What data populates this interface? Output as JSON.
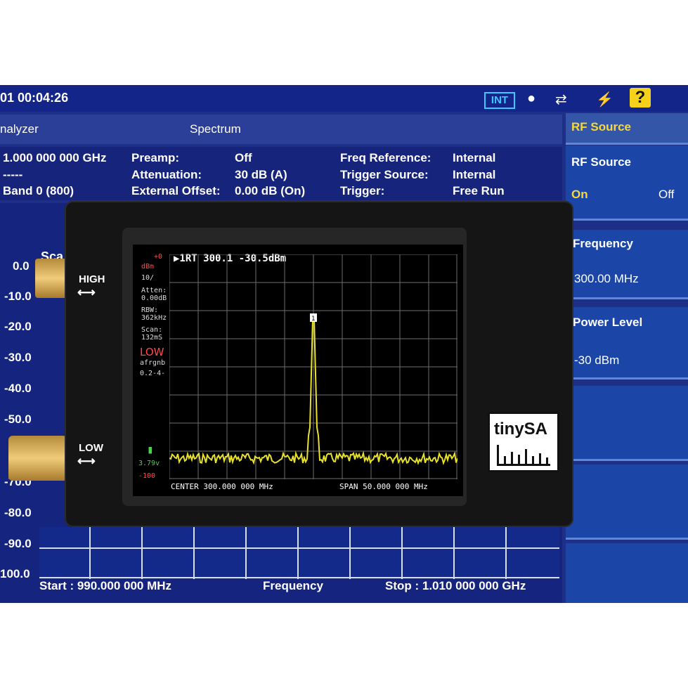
{
  "analyzer": {
    "time": "01 00:04:26",
    "int_badge": "INT",
    "mode": "nalyzer",
    "spectrum_tab": "Spectrum",
    "info": {
      "freq": "1.000 000 000 GHz",
      "dashes": "-----",
      "band": "Band 0 (800)",
      "preamp_label": "Preamp:",
      "preamp_value": "Off",
      "atten_label": "Attenuation:",
      "atten_value": "30 dB  (A)",
      "offset_label": "External Offset:",
      "offset_value": "0.00 dB  (On)",
      "freqref_label": "Freq Reference:",
      "freqref_value": "Internal",
      "trigsrc_label": "Trigger Source:",
      "trigsrc_value": "Internal",
      "trig_label": "Trigger:",
      "trig_value": "Free Run"
    },
    "softkeys": {
      "title": "RF Source",
      "rf_source": "RF Source",
      "on": "On",
      "off": "Off",
      "frequency_label": "Frequency",
      "frequency_value": "300.00 MHz",
      "power_label": "Power Level",
      "power_value": "-30 dBm"
    },
    "scale_label": "Sca",
    "y_labels": [
      "0.0",
      "-10.0",
      "-20.0",
      "-30.0",
      "-40.0",
      "-50.0",
      "-70.0",
      "-80.0",
      "-90.0",
      "100.0"
    ],
    "start": "Start : 990.000 000 MHz",
    "center_label": "Frequency",
    "stop": "Stop : 1.010 000 000 GHz"
  },
  "device": {
    "high": "HIGH",
    "low": "LOW",
    "logo": "tinySA"
  },
  "tinysa": {
    "marker": "▶1RT  300.1 -30.5dBm",
    "ref_level": "+0",
    "unit": "dBm",
    "scale": "10/",
    "atten": "Atten:",
    "atten_val": "0.00dB",
    "rbw": "RBW:",
    "rbw_val": "362kHz",
    "scan": "Scan:",
    "scan_val": "132mS",
    "mode": "LOW",
    "flags": "afrgnb",
    "version": "0.2-4-",
    "battery": "3.79v",
    "bottom_level": "-100",
    "center": "CENTER 300.000 000 MHz",
    "span": "SPAN 50.000 000 MHz",
    "trace_color": "#e8e12a"
  }
}
